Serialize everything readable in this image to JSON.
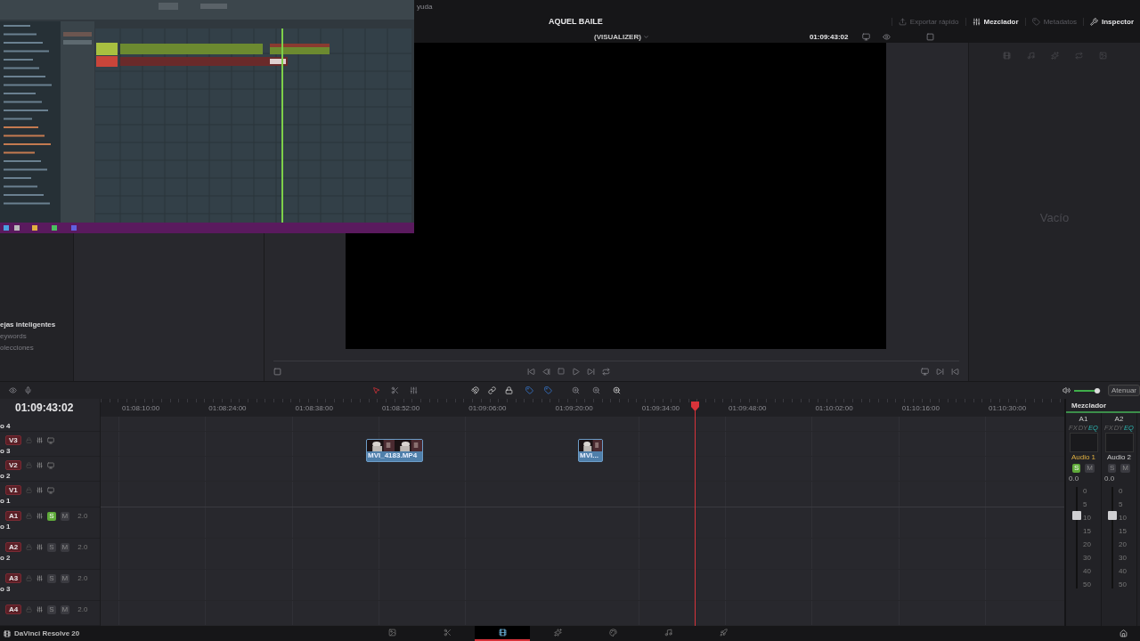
{
  "menu_fragment": "yuda",
  "project_title": "AQUEL BAILE",
  "header_buttons": [
    {
      "label": "Exportar rápido",
      "disabled": true
    },
    {
      "label": "Mezclador",
      "disabled": false
    },
    {
      "label": "Metadatos",
      "disabled": true
    },
    {
      "label": "Inspector",
      "disabled": false
    }
  ],
  "viewer": {
    "source": "(VISUALIZER)",
    "timecode": "01:09:43:02"
  },
  "inspector": {
    "empty_text": "Vacío"
  },
  "media_pool": [
    {
      "kind": "heading",
      "label": "ejas inteligentes"
    },
    {
      "kind": "item",
      "label": "eywords"
    },
    {
      "kind": "item",
      "label": "olecciones"
    }
  ],
  "timeline": {
    "timecode": "01:09:43:02",
    "volume": {
      "level": 0.88
    },
    "duck_label": "Atenuar",
    "ruler": [
      "01:08:10:00",
      "01:08:24:00",
      "01:08:38:00",
      "01:08:52:00",
      "01:09:06:00",
      "01:09:20:00",
      "01:09:34:00",
      "01:09:48:00",
      "01:10:02:00",
      "01:10:16:00",
      "01:10:30:00"
    ],
    "tracks": [
      {
        "kind": "video",
        "name": "o 4"
      },
      {
        "kind": "video",
        "badge": "V3",
        "name": "o 3"
      },
      {
        "kind": "video",
        "badge": "V2",
        "name": "o 2"
      },
      {
        "kind": "video",
        "badge": "V1",
        "name": "o 1"
      },
      {
        "kind": "audio",
        "badge": "A1",
        "name": "o 1",
        "solo": true,
        "solo_label": "S",
        "mute_label": "M",
        "format": "2.0"
      },
      {
        "kind": "audio",
        "badge": "A2",
        "name": "o 2",
        "solo": false,
        "solo_label": "S",
        "mute_label": "M",
        "format": "2.0"
      },
      {
        "kind": "audio",
        "badge": "A3",
        "name": "o 3",
        "solo": false,
        "solo_label": "S",
        "mute_label": "M",
        "format": "2.0"
      },
      {
        "kind": "audio",
        "badge": "A4",
        "solo": false,
        "solo_label": "S",
        "mute_label": "M",
        "format": "2.0"
      }
    ],
    "clips": [
      {
        "name": "MVI_4183.MP4"
      },
      {
        "name": "MVI..."
      }
    ]
  },
  "mixer": {
    "title": "Mezclador",
    "channels": [
      {
        "id": "A1",
        "effects": [
          {
            "label": "FX",
            "on": false
          },
          {
            "label": "DY",
            "on": false
          },
          {
            "label": "EQ",
            "on": true
          }
        ],
        "name": "Audio 1",
        "selected": true,
        "solo": true,
        "solo_label": "S",
        "mute_label": "M",
        "gain": "0.0",
        "level": 0.72,
        "scale": [
          "0",
          "5",
          "10",
          "15",
          "20",
          "30",
          "40",
          "50"
        ]
      },
      {
        "id": "A2",
        "effects": [
          {
            "label": "FX",
            "on": false
          },
          {
            "label": "DY",
            "on": false
          },
          {
            "label": "EQ",
            "on": true
          }
        ],
        "name": "Audio 2",
        "selected": false,
        "solo": false,
        "solo_label": "S",
        "mute_label": "M",
        "gain": "0.0",
        "level": 0.72,
        "scale": [
          "0",
          "5",
          "10",
          "15",
          "20",
          "30",
          "40",
          "50"
        ]
      }
    ]
  },
  "status": {
    "app_name": "DaVinci Resolve 20",
    "pages": [
      {
        "selected": false
      },
      {
        "selected": false
      },
      {
        "selected": true
      },
      {
        "selected": false
      },
      {
        "selected": false
      },
      {
        "selected": false
      },
      {
        "selected": false
      }
    ]
  }
}
